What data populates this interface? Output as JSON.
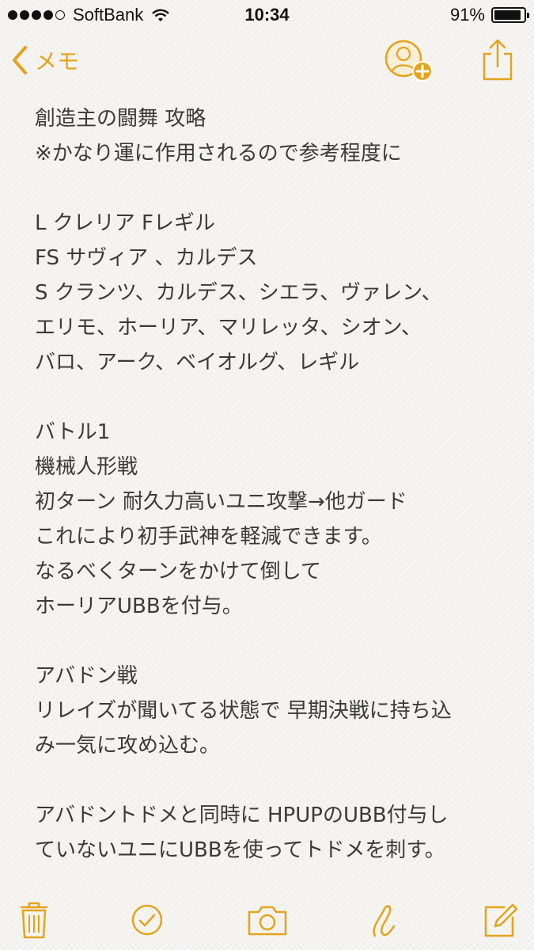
{
  "status_bar": {
    "carrier": "SoftBank",
    "time": "10:34",
    "battery_text": "91%",
    "battery_level": 0.91
  },
  "nav": {
    "back_label": "メモ"
  },
  "note": {
    "lines": [
      "創造主の闘舞 攻略",
      "※かなり運に作用されるので参考程度に",
      "",
      "L クレリア Fレギル",
      "FS サヴィア 、カルデス",
      "S クランツ、カルデス、シエラ、ヴァレン、",
      "エリモ、ホーリア、マリレッタ、シオン、",
      "バロ、アーク、ベイオルグ、レギル",
      "",
      "バトル1",
      "機械人形戦",
      "初ターン 耐久力高いユニ攻撃→他ガード",
      "これにより初手武神を軽減できます。",
      "なるべくターンをかけて倒して",
      "ホーリアUBBを付与。",
      "",
      "アバドン戦",
      "リレイズが聞いてる状態で 早期決戦に持ち込",
      "み一気に攻め込む。",
      "",
      "アバドントドメと同時に HPUPのUBB付与し",
      "ていないユニにUBBを使ってトドメを刺す。"
    ]
  },
  "colors": {
    "accent": "#e3a41c",
    "text": "#3a3a3a",
    "background": "#f6f5f2"
  }
}
